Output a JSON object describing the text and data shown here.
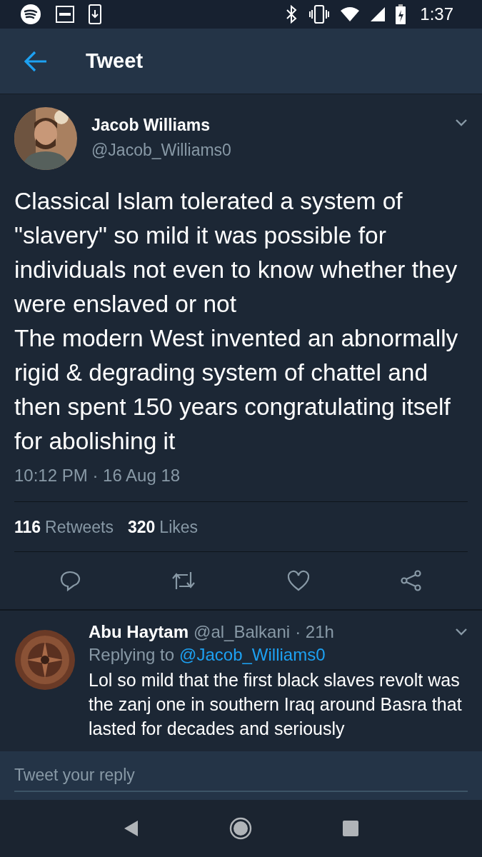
{
  "status_bar": {
    "time": "1:37"
  },
  "header": {
    "title": "Tweet"
  },
  "tweet": {
    "name": "Jacob Williams",
    "handle": "@Jacob_Williams0",
    "paragraphs": [
      "Classical Islam tolerated a system of \"slavery\" so mild it was possible for individuals not even to know whether they were enslaved or not",
      "The modern West invented an abnormally rigid & degrading system of chattel and then spent 150 years congratulating itself for abolishing it"
    ],
    "timestamp": "10:12 PM · 16 Aug 18",
    "stats": [
      {
        "count": "116",
        "label": "Retweets"
      },
      {
        "count": "320",
        "label": "Likes"
      }
    ]
  },
  "reply": {
    "name": "Abu Haytam",
    "handle": "@al_Balkani",
    "time": "· 21h",
    "replying_prefix": "Replying to",
    "replying_to": "@Jacob_Williams0",
    "text": "Lol so mild that the first black slaves revolt was the zanj one in southern Iraq around Basra that lasted for decades and seriously"
  },
  "compose": {
    "placeholder": "Tweet your reply"
  }
}
